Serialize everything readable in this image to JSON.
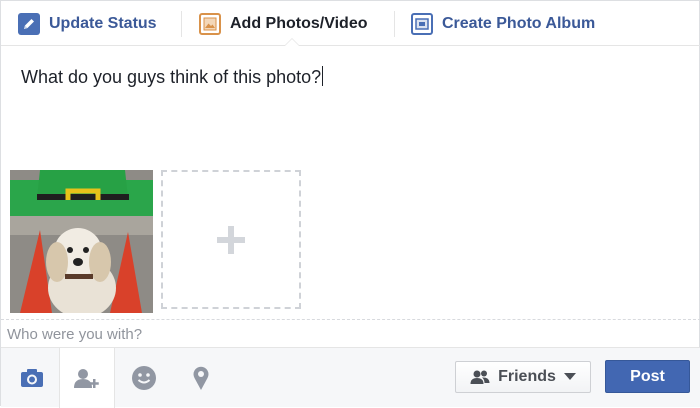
{
  "tabs": {
    "update_status": "Update Status",
    "add_photos": "Add Photos/Video",
    "create_album": "Create Photo Album"
  },
  "composer": {
    "status_text": "What do you guys think of this photo?"
  },
  "photos": {
    "thumbnail_subject": "dog-with-leprechaun-hat",
    "add_icon": "plus-icon"
  },
  "with": {
    "placeholder": "Who were you with?",
    "value": ""
  },
  "toolbar": {
    "tools": [
      "camera-icon",
      "tag-friends-icon",
      "feeling-icon",
      "location-pin-icon"
    ],
    "audience_label": "Friends",
    "post_label": "Post"
  },
  "colors": {
    "brand_blue": "#3b5998",
    "post_button": "#4267b2"
  }
}
